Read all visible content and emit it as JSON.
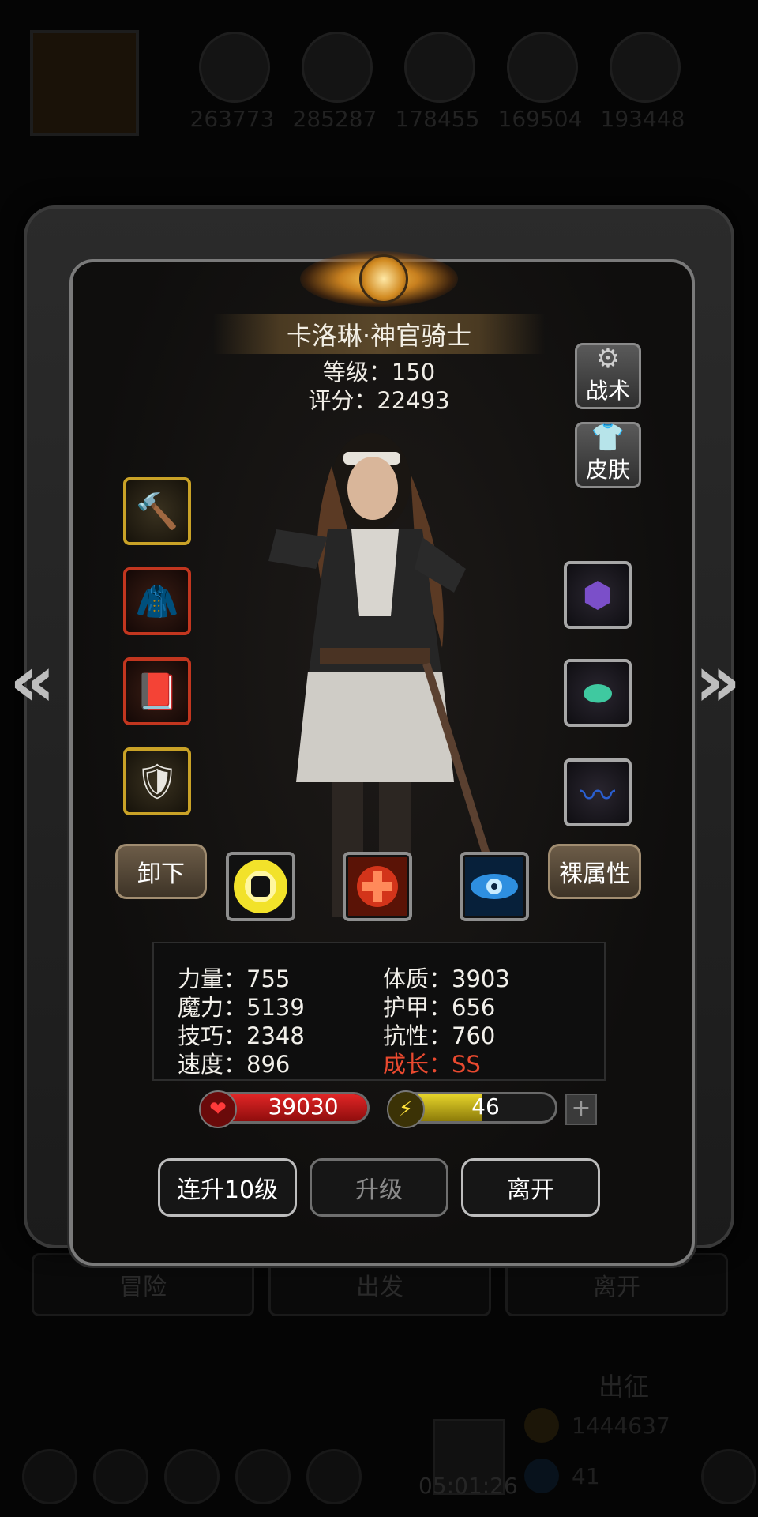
{
  "background": {
    "resources": [
      "263773",
      "285287",
      "178455",
      "169504",
      "193448"
    ],
    "bottom_buttons": [
      "冒险",
      "出发",
      "离开"
    ],
    "expedition_label": "出征",
    "gold_amount": "1444637",
    "gem_amount": "41",
    "timer": "05:01:26"
  },
  "hero": {
    "name": "卡洛琳·神官骑士",
    "level_line": "等级：150",
    "score_line": "评分：22493"
  },
  "side_buttons": {
    "tactics": "战术",
    "skin": "皮肤"
  },
  "equipment": {
    "left": [
      "mace-icon",
      "robe-icon",
      "tome-icon",
      "helmet-icon"
    ],
    "right": [
      "dark-gem-icon",
      "jade-stone-icon",
      "blue-feather-icon"
    ]
  },
  "controls": {
    "unequip": "卸下",
    "bare_stats": "裸属性"
  },
  "skills": [
    "fist-icon",
    "heal-cross-icon",
    "eye-icon"
  ],
  "stats": {
    "strength": "力量：755",
    "magic": "魔力：5139",
    "skill": "技巧：2348",
    "speed": "速度：896",
    "constitution": "体质：3903",
    "armor": "护甲：656",
    "resistance": "抗性：760",
    "growth": "成长：SS"
  },
  "bars": {
    "hp": "39030",
    "energy": "46",
    "energy_fill": 0.55
  },
  "actions": {
    "level_up_10": "连升10级",
    "level_up": "升级",
    "leave": "离开"
  },
  "colors": {
    "hp": "#c81a1a",
    "energy": "#c9b21a",
    "growth": "#e8492f"
  }
}
